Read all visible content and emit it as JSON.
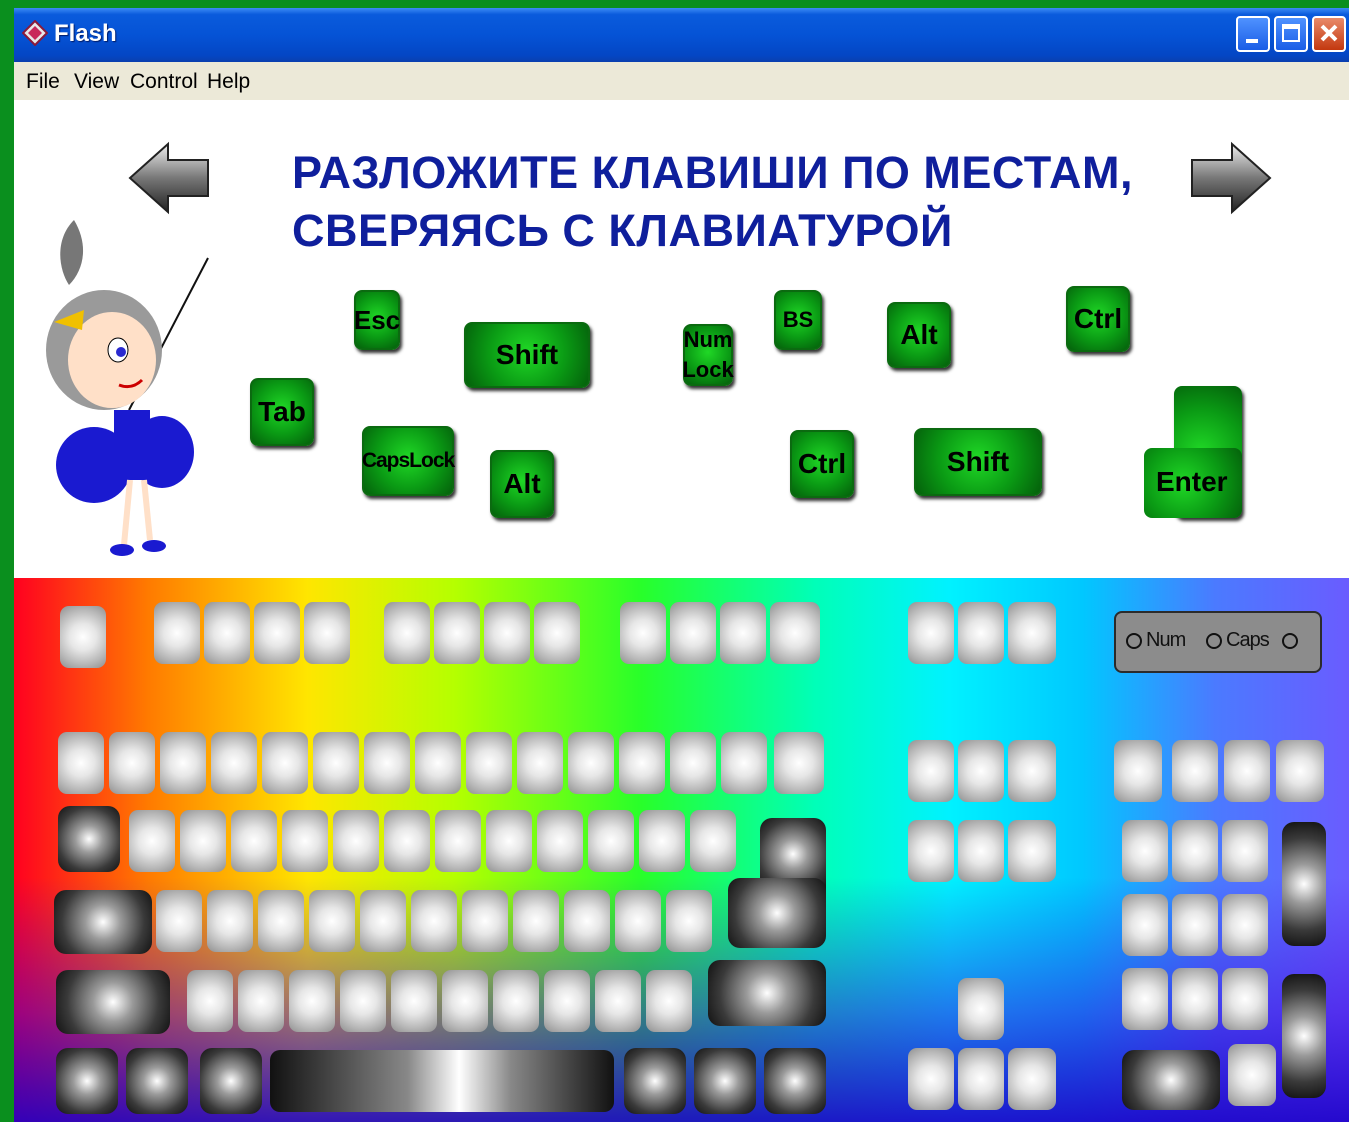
{
  "window": {
    "title": "Flash",
    "icon": "flash-app-icon"
  },
  "menu": {
    "items": [
      "File",
      "View",
      "Control",
      "Help"
    ]
  },
  "heading": {
    "line1": "РАЗЛОЖИТЕ КЛАВИШИ ПО МЕСТАМ,",
    "line2": "СВЕРЯЯСЬ С КЛАВИАТУРОЙ"
  },
  "navigation": {
    "back": "arrow-left-icon",
    "forward": "arrow-right-icon"
  },
  "draggable_keys": {
    "esc": "Esc",
    "shift_left": "Shift",
    "num_lock_1": "Num",
    "num_lock_2": "Lock",
    "bs": "BS",
    "alt_right": "Alt",
    "ctrl_right": "Ctrl",
    "tab": "Tab",
    "caps_lock": "CapsLock",
    "alt_left": "Alt",
    "ctrl_left": "Ctrl",
    "shift_right": "Shift",
    "enter": "Enter"
  },
  "indicators": {
    "num": "Num",
    "caps": "Caps"
  },
  "colors": {
    "title_bar": "#0553d6",
    "heading": "#0f1f9c",
    "key_green": "#0a9a14",
    "frame_green": "#0a8f1e"
  }
}
